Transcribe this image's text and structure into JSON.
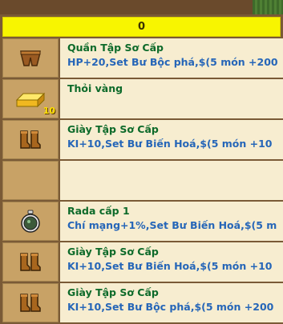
{
  "header": {
    "value": "0"
  },
  "items": [
    {
      "icon": "pants-icon",
      "name": "Quần Tập Sơ Cấp",
      "desc": "HP+20,Set Bư Bộc phá,$(5 món +200",
      "qty": ""
    },
    {
      "icon": "gold-bar-icon",
      "name": "Thỏi vàng",
      "desc": "",
      "qty": "10"
    },
    {
      "icon": "boots-icon",
      "name": "Giày Tập Sơ Cấp",
      "desc": "KI+10,Set Bư Biến Hoá,$(5 món +10",
      "qty": ""
    },
    {
      "icon": "",
      "name": "",
      "desc": "",
      "qty": ""
    },
    {
      "icon": "radar-icon",
      "name": "Rada cấp 1",
      "desc": "Chí mạng+1%,Set Bư Biến Hoá,$(5 m",
      "qty": ""
    },
    {
      "icon": "boots-icon",
      "name": "Giày Tập Sơ Cấp",
      "desc": "KI+10,Set Bư Biến Hoá,$(5 món +10",
      "qty": ""
    },
    {
      "icon": "boots-icon",
      "name": "Giày Tập Sơ Cấp",
      "desc": "KI+10,Set Bư Bộc phá,$(5 món +200",
      "qty": ""
    }
  ]
}
